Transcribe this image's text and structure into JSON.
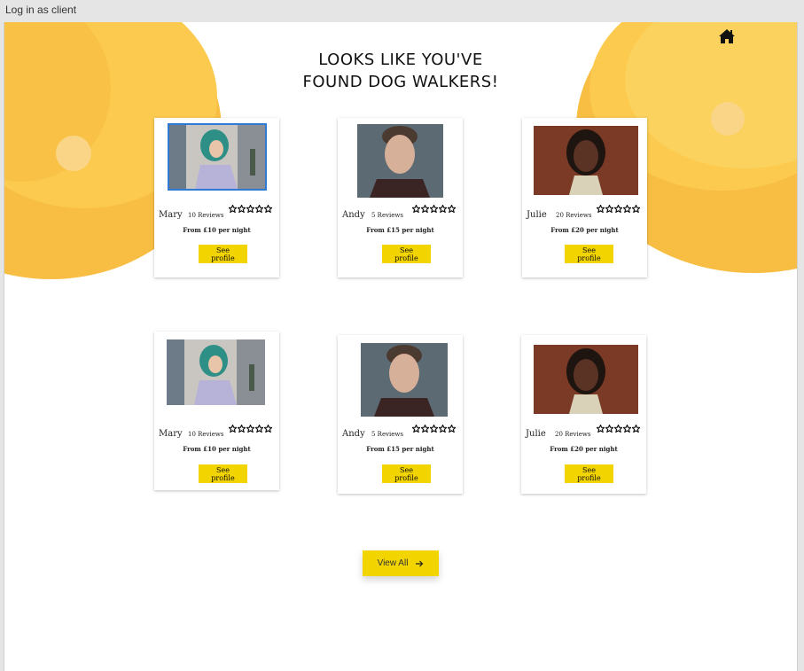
{
  "window": {
    "title": "Log in as client"
  },
  "page": {
    "title_line1": "LOOKS LIKE YOU'VE",
    "title_line2": "FOUND DOG WALKERS!"
  },
  "colors": {
    "accent": "#f1d400",
    "blob": "#f8be43",
    "selection": "#2f7ad6"
  },
  "icons": {
    "home": "home-icon",
    "star": "star-outline-icon",
    "arrow": "arrow-right-icon"
  },
  "walkers": [
    {
      "name": "Mary",
      "reviews": "10 Reviews",
      "price": "From £10 per night",
      "button": "See profile",
      "rating": 0
    },
    {
      "name": "Andy",
      "reviews": "5 Reviews",
      "price": "From £15 per night",
      "button": "See profile",
      "rating": 0
    },
    {
      "name": "Julie",
      "reviews": "20 Reviews",
      "price": "From £20 per night",
      "button": "See profile",
      "rating": 0
    },
    {
      "name": "Mary",
      "reviews": "10 Reviews",
      "price": "From £10 per night",
      "button": "See profile",
      "rating": 0
    },
    {
      "name": "Andy",
      "reviews": "5 Reviews",
      "price": "From £15 per night",
      "button": "See profile",
      "rating": 0
    },
    {
      "name": "Julie",
      "reviews": "20 Reviews",
      "price": "From £20 per night",
      "button": "See profile",
      "rating": 0
    }
  ],
  "view_all": {
    "label": "View All"
  }
}
